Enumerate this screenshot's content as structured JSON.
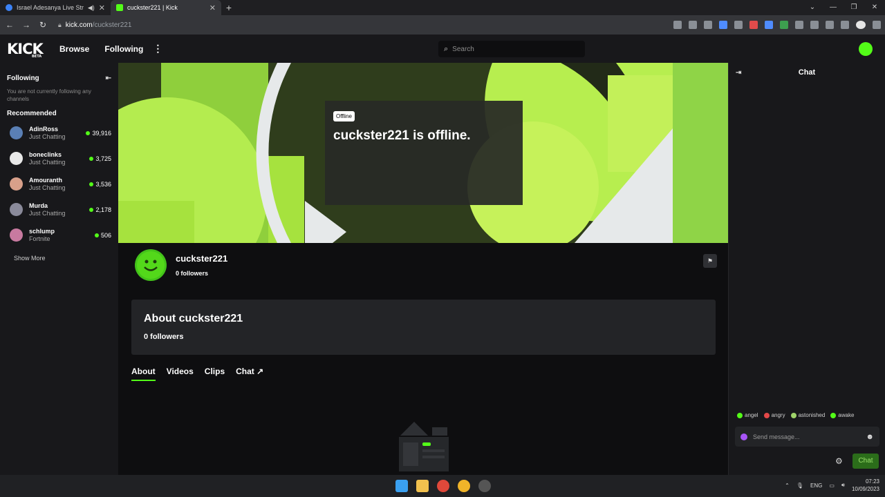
{
  "browser": {
    "tabs": [
      {
        "title": "Israel Adesanya Live Stream",
        "active": false,
        "close": "✕",
        "audio_icon": "speaker-icon"
      },
      {
        "title": "cuckster221 | Kick",
        "active": true,
        "close": "✕"
      }
    ],
    "new_tab": "+",
    "url_host": "kick.com",
    "url_path": "/cuckster221"
  },
  "kick_nav": {
    "logo": "KICK",
    "logo_badge": "BETA",
    "browse": "Browse",
    "following": "Following",
    "more": "⋮",
    "search_placeholder": "Search"
  },
  "sidebar": {
    "following_title": "Following",
    "following_note": "You are not currently following any channels",
    "recommended_title": "Recommended",
    "channels": [
      {
        "name": "AdinRoss",
        "category": "Just Chatting",
        "viewers": "39,916",
        "avatar_color": "#5a7fb5"
      },
      {
        "name": "boneclinks",
        "category": "Just Chatting",
        "viewers": "3,725",
        "avatar_color": "#e8e8e8"
      },
      {
        "name": "Amouranth",
        "category": "Just Chatting",
        "viewers": "3,536",
        "avatar_color": "#d8a08a"
      },
      {
        "name": "Murda",
        "category": "Just Chatting",
        "viewers": "2,178",
        "avatar_color": "#8a8a9a"
      },
      {
        "name": "schlump",
        "category": "Fortnite",
        "viewers": "506",
        "avatar_color": "#c87aa0"
      }
    ],
    "show_more": "Show More"
  },
  "banner": {
    "badge": "Offline",
    "message": "cuckster221 is offline."
  },
  "profile": {
    "username": "cuckster221",
    "followers": "0 followers"
  },
  "about": {
    "title": "About cuckster221",
    "followers": "0 followers"
  },
  "tabs": [
    {
      "label": "About",
      "active": true
    },
    {
      "label": "Videos",
      "active": false
    },
    {
      "label": "Clips",
      "active": false
    },
    {
      "label": "Chat ↗",
      "active": false
    }
  ],
  "chat": {
    "title": "Chat",
    "emotes": [
      {
        "label": "angel",
        "color": "#53fc18"
      },
      {
        "label": "angry",
        "color": "#e34848"
      },
      {
        "label": "astonished",
        "color": "#9fd36a"
      },
      {
        "label": "awake",
        "color": "#53fc18"
      }
    ],
    "input_placeholder": "Send message...",
    "send_button": "Chat"
  },
  "taskbar": {
    "language": "ENG",
    "time": "07:23",
    "date": "10/09/2023"
  },
  "colors": {
    "accent": "#53fc18",
    "background": "#0e0e10",
    "panel": "#18181b"
  }
}
